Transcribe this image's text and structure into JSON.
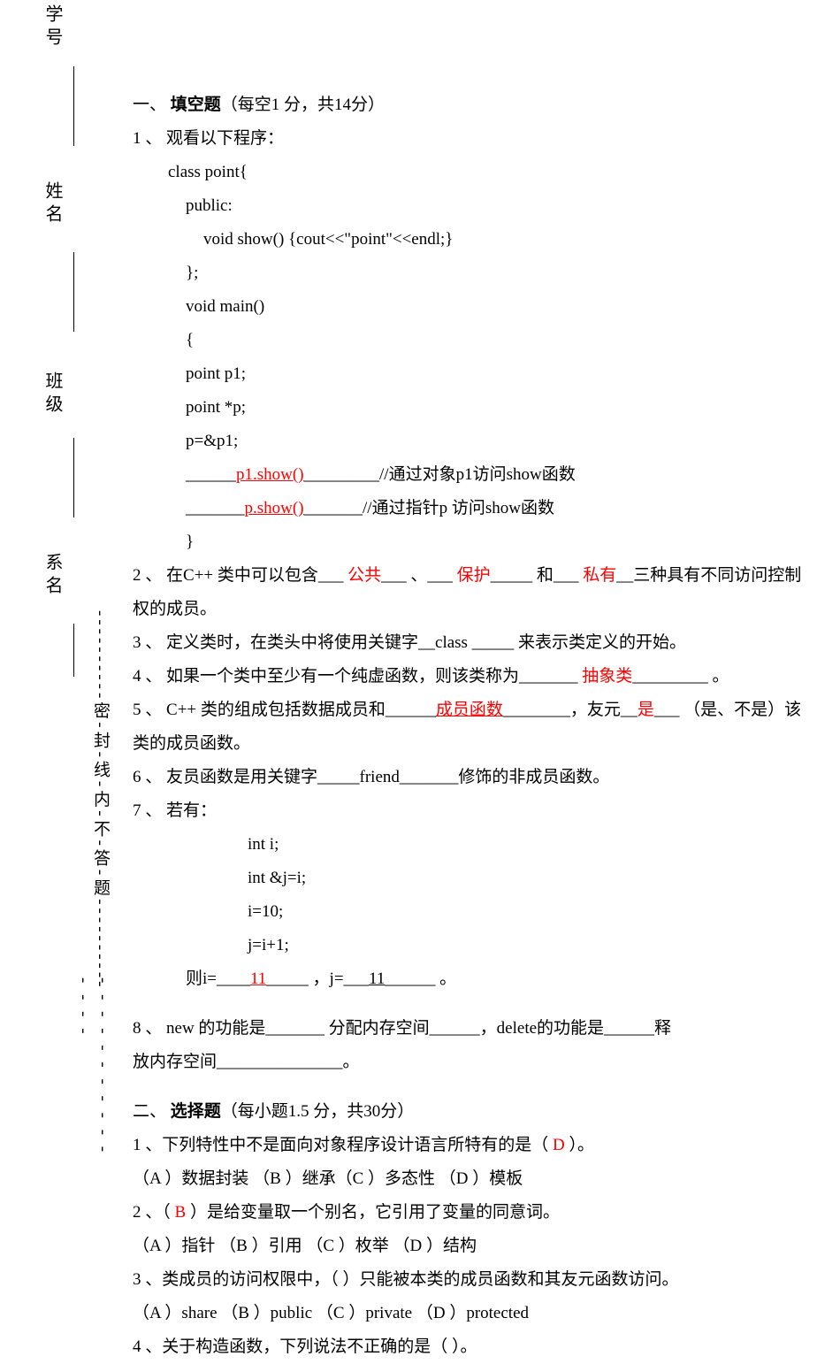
{
  "sidebar": {
    "labels": {
      "xuehao": "学号",
      "xingming": "姓名",
      "banji": "班级",
      "ximing": "系名"
    },
    "seal_text": "----------密-封-线-内-不-答-题----------",
    "seal_dashes": "- - - - - - - - - - - - - - -"
  },
  "section1": {
    "num": "一、",
    "title": "填空题",
    "scoring": "（每空1 分，共14分）",
    "q1": {
      "num": "1 、",
      "lead": "观看以下程序：",
      "code": {
        "l1": "class point{",
        "l2": "public:",
        "l3": "void show() {cout<<\"point\"<<endl;}",
        "l4": "};",
        "l5": "void main()",
        "l6": "{",
        "l7": "point p1;",
        "l8": "point *p;",
        "l9": "p=&p1;",
        "l10_pre": "______",
        "l10_ans": "p1.show()",
        "l10_post": "_________//通过对象p1访问show函数",
        "l11_pre": "_______",
        "l11_ans": "p.show()",
        "l11_post": "_______//通过指针p 访问show函数",
        "l12": "}"
      }
    },
    "q2": {
      "num": "2 、",
      "t1": "在C++ 类中可以包含___ ",
      "a1": "公共",
      "t2": "___ 、___ ",
      "a2": "保护",
      "t3": "_____ 和___ ",
      "a3": "私有",
      "t4": "__三种具有不同访问控制权的成员。"
    },
    "q3": {
      "num": "3 、",
      "text": "定义类时，在类头中将使用关键字__class _____ 来表示类定义的开始。"
    },
    "q4": {
      "num": "4 、",
      "t1": "如果一个类中至少有一个纯虚函数，则该类称为_______ ",
      "a1": "抽象类",
      "t2": "_________ 。"
    },
    "q5": {
      "num": "5 、",
      "t1": "C++ 类的组成包括数据成员和______",
      "a1": "成员函数",
      "t2": "________，友元__",
      "a2": "是",
      "t3": "___ （是、不是）该类的成员函数。"
    },
    "q6": {
      "num": "6 、",
      "text": "友员函数是用关键字_____friend_______修饰的非成员函数。"
    },
    "q7": {
      "num": "7 、",
      "lead": "若有：",
      "code": {
        "l1": "int i;",
        "l2": "int &j=i;",
        "l3": "i=10;",
        "l4": "j=i+1;"
      },
      "res_pre": "则i=____",
      "res_a1": "11",
      "res_mid": "_____ ，j=___",
      "res_a2": "11",
      "res_post": "______ 。"
    },
    "q8": {
      "num": "8 、",
      "line1": "new 的功能是_______ 分配内存空间______，delete的功能是______释",
      "line2": "放内存空间_______________。"
    }
  },
  "section2": {
    "num": "二、",
    "title": "选择题",
    "scoring": "（每小题1.5 分，共30分）",
    "q1": {
      "num": "1 、",
      "t1": "下列特性中不是面向对象程序设计语言所特有的是（   ",
      "ans": "D",
      "t2": "   ）。",
      "opts": "（A ）数据封装  （B ）继承（C ）多态性  （D ）模板"
    },
    "q2": {
      "num": "2 、",
      "t1": "（   ",
      "ans": "B",
      "t2": "   ）是给变量取一个别名，它引用了变量的同意词。",
      "opts": "（A ）指针  （B ）引用  （C ）枚举  （D ）结构"
    },
    "q3": {
      "num": "3 、",
      "text": "类成员的访问权限中，（     ）只能被本类的成员函数和其友元函数访问。",
      "opts": "（A ）share （B ）public   （C ）private   （D ）protected"
    },
    "q4": {
      "num": "4 、",
      "text": "关于构造函数，下列说法不正确的是（       ）。"
    }
  }
}
